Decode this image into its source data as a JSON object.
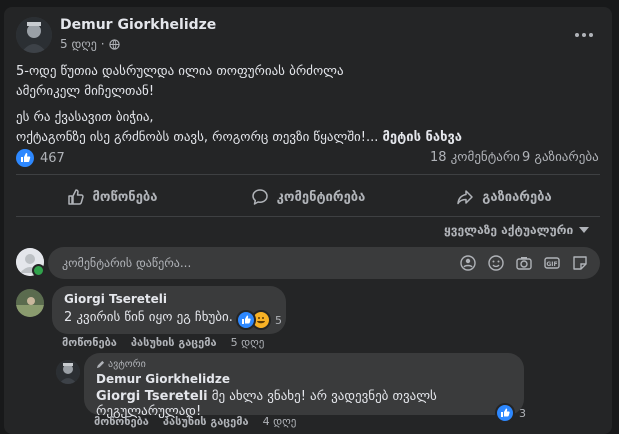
{
  "post": {
    "author": "Demur Giorkhelidze",
    "time": "5 დღე",
    "text_line1": "5-ოდე წუთია დასრულდა ილია თოფურიას ბრძოლა",
    "text_line2": "ამერიკელ მიჩელთან!",
    "text_line3": "ეს რა ქვასავით ბიჭია,",
    "text_line4": "ოქტაგონზე ისე გრძნობს თავს, როგორც თევზი წყალში!...",
    "see_more": "მეტის ნახვა"
  },
  "stats": {
    "reactions": "467",
    "comments": "18 კომენტარი",
    "shares": "9 გაზიარება"
  },
  "actions": {
    "like": "მოწონება",
    "comment": "კომენტირება",
    "share": "გაზიარება"
  },
  "sort": {
    "label": "ყველაზე აქტუალური"
  },
  "compose": {
    "placeholder": "კომენტარის დაწერა..."
  },
  "comments": [
    {
      "author": "Giorgi Tsereteli",
      "text": "2 კვირის წინ იყო ეგ ჩხუბი.",
      "reactions": "5",
      "like": "მოწონება",
      "reply": "პასუხის გაცემა",
      "time": "5 დღე"
    }
  ],
  "reply": {
    "badge": "ავტორი",
    "author": "Demur Giorkhelidze",
    "mention": "Giorgi Tsereteli",
    "text": " მე ახლა ვნახე! არ ვადევნებ თვალს რეგულარულად!",
    "reactions": "3",
    "like": "მოწონება",
    "reply": "პასუხის გაცემა",
    "time": "4 დღე"
  },
  "colors": {
    "background": "#18191a",
    "card": "#242526",
    "bubble": "#3a3b3c",
    "like_blue": "#2d88ff",
    "online_green": "#31a24c"
  }
}
